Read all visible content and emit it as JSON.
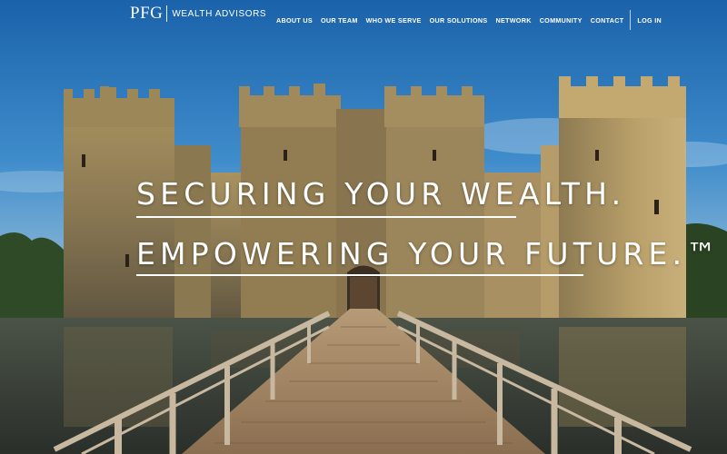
{
  "brand": {
    "mark": "PFG",
    "name": "WEALTH ADVISORS"
  },
  "nav": {
    "items": [
      "ABOUT US",
      "OUR TEAM",
      "WHO WE SERVE",
      "OUR SOLUTIONS",
      "NETWORK",
      "COMMUNITY",
      "CONTACT"
    ],
    "login": "LOG IN"
  },
  "hero": {
    "headline_line1": "SECURING YOUR WEALTH.",
    "headline_line2": "EMPOWERING YOUR FUTURE.™",
    "image_subject": "castle-with-moat-and-bridge"
  },
  "colors": {
    "sky_top": "#1f6fb5",
    "sky_bottom": "#bcd3df",
    "stone": "#8c7a57",
    "water": "#3d4439",
    "text": "#ffffff"
  }
}
